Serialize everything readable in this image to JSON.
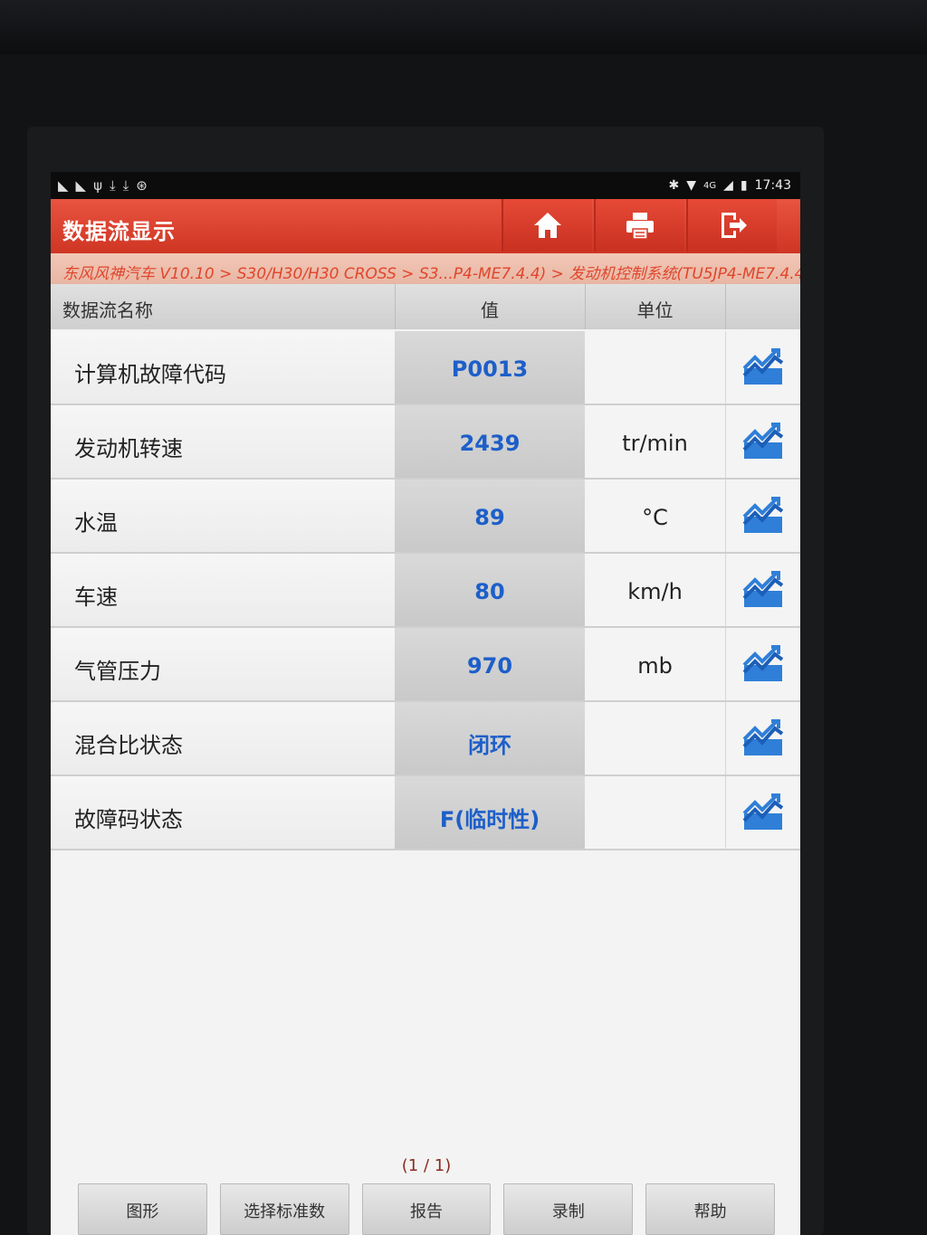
{
  "status_bar": {
    "time": "17:43",
    "network": "4G"
  },
  "title_bar": {
    "title": "数据流显示"
  },
  "breadcrumb": "东风风神汽车 V10.10 > S30/H30/H30 CROSS > S3...P4-ME7.4.4) > 发动机控制系统(TU5JP4-ME7.4.4)",
  "table": {
    "headers": {
      "name": "数据流名称",
      "value": "值",
      "unit": "单位"
    },
    "rows": [
      {
        "name": "计算机故障代码",
        "value": "P0013",
        "unit": ""
      },
      {
        "name": "发动机转速",
        "value": "2439",
        "unit": "tr/min"
      },
      {
        "name": "水温",
        "value": "89",
        "unit": "°C"
      },
      {
        "name": "车速",
        "value": "80",
        "unit": "km/h"
      },
      {
        "name": "气管压力",
        "value": "970",
        "unit": "mb"
      },
      {
        "name": "混合比状态",
        "value": "闭环",
        "unit": ""
      },
      {
        "name": "故障码状态",
        "value": "F(临时性)",
        "unit": ""
      }
    ]
  },
  "pager": "(1 / 1)",
  "bottom_buttons": {
    "graph": "图形",
    "select_standard": "选择标准数",
    "report": "报告",
    "record": "录制",
    "help": "帮助"
  },
  "colors": {
    "title_red": "#d83a27",
    "value_blue": "#1d5fc9",
    "breadcrumb_text": "#e0462c"
  }
}
